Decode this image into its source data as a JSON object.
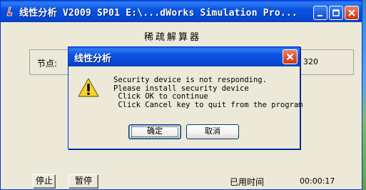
{
  "main_window": {
    "title": "线性分析 V2009 SP01 E:\\...dWorks Simulation Pro...",
    "app_icon": "app-icon"
  },
  "solver": {
    "title": "稀疏解算器",
    "node_label": "节点:",
    "node_value": "320"
  },
  "bottom": {
    "stop_label": "停止",
    "pause_label": "暂停",
    "elapsed_label": "已用时间",
    "elapsed_value": "00:00:17"
  },
  "dialog": {
    "title": "线性分析",
    "icon": "warning-icon",
    "message_lines": [
      "Security device is not responding.",
      "Please install security device",
      " Click OK to continue",
      " Click Cancel key to quit from the program"
    ],
    "ok_label": "确定",
    "cancel_label": "取消"
  },
  "colors": {
    "titlebar_blue": "#0a53e0",
    "close_red": "#d9502c",
    "window_bg": "#ece9d8"
  }
}
